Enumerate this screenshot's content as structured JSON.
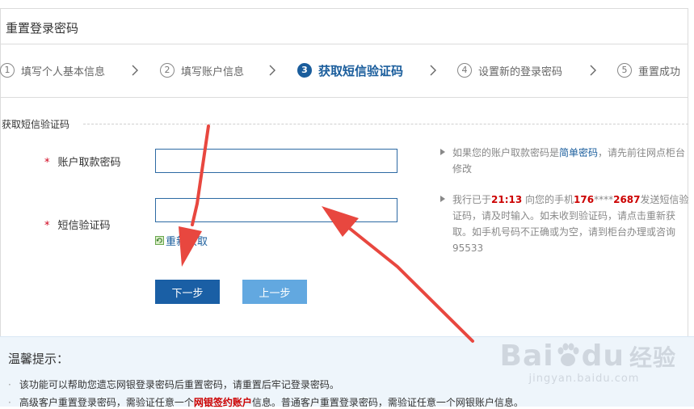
{
  "page": {
    "title": "重置登录密码"
  },
  "steps": [
    {
      "num": "1",
      "label": "填写个人基本信息"
    },
    {
      "num": "2",
      "label": "填写账户信息"
    },
    {
      "num": "3",
      "label": "获取短信验证码"
    },
    {
      "num": "4",
      "label": "设置新的登录密码"
    },
    {
      "num": "5",
      "label": "重置成功"
    }
  ],
  "section": {
    "title": "获取短信验证码"
  },
  "form": {
    "required_mark": "*",
    "withdraw_password": {
      "label": "账户取款密码",
      "value": ""
    },
    "sms_code": {
      "label": "短信验证码",
      "value": ""
    },
    "refresh_label": "重新获取"
  },
  "hints": {
    "hint1": {
      "pre": "如果您的账户取款密码是",
      "link": "简单密码",
      "post": "，请先前往网点柜台修改"
    },
    "hint2": {
      "pre": "我行已于",
      "time": "21:13",
      "mid": " 向您的手机",
      "phone_prefix": "176",
      "phone_mask": "****",
      "phone_suffix": "2687",
      "post": "发送短信验证码，请及时输入。如未收到验证码，请点击重新获取。如手机号码不正确或为空，请到柜台办理或咨询95533"
    }
  },
  "buttons": {
    "next": "下一步",
    "prev": "上一步"
  },
  "tips": {
    "title": "温馨提示：",
    "bullet": "·",
    "line1": "该功能可以帮助您遗忘网银登录密码后重置密码，请重置后牢记登录密码。",
    "line2_pre": "高级客户重置登录密码，需验证任意一个",
    "line2_red": "网银签约账户",
    "line2_post": "信息。普通客户重置登录密码，需验证任意一个网银账户信息。"
  },
  "watermark": {
    "main": "Bai",
    "main2": "du",
    "cn": "经验",
    "sub": "jingyan.baidu.com"
  },
  "colors": {
    "primary": "#1a5fa5",
    "secondary_button": "#62a8e0",
    "annotation_arrow": "#e8473f",
    "required": "#d0021b"
  }
}
